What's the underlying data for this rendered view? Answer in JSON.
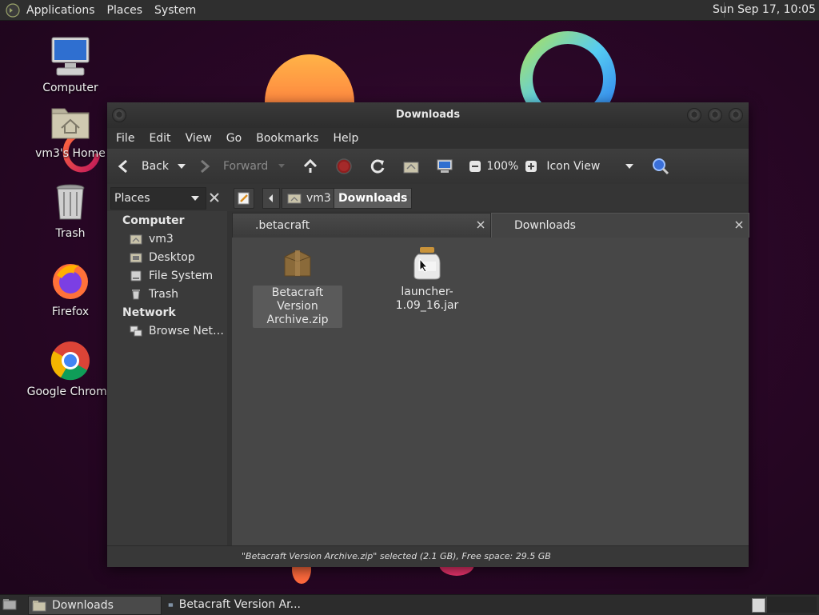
{
  "top_panel": {
    "menus": [
      "Applications",
      "Places",
      "System"
    ],
    "clock": "Sun Sep 17, 10:05"
  },
  "desktop_icons": [
    {
      "label": "Computer",
      "icon": "computer-icon"
    },
    {
      "label": "vm3's Home",
      "icon": "home-folder-icon"
    },
    {
      "label": "Trash",
      "icon": "trash-icon"
    },
    {
      "label": "Firefox",
      "icon": "firefox-icon"
    },
    {
      "label": "Google Chrome",
      "icon": "chrome-icon"
    }
  ],
  "window": {
    "title": "Downloads",
    "menus": [
      "File",
      "Edit",
      "View",
      "Go",
      "Bookmarks",
      "Help"
    ],
    "toolbar": {
      "back": "Back",
      "forward": "Forward",
      "zoom": "100%",
      "view_mode": "Icon View"
    },
    "places_label": "Places",
    "breadcrumbs": [
      "vm3",
      "Downloads"
    ],
    "sidebar": {
      "computer_heading": "Computer",
      "computer_items": [
        "vm3",
        "Desktop",
        "File System",
        "Trash"
      ],
      "network_heading": "Network",
      "network_items": [
        "Browse Net…"
      ]
    },
    "tabs": [
      ".betacraft",
      "Downloads"
    ],
    "files": [
      {
        "name": "Betacraft Version Archive.zip",
        "line1": "Betacraft Version",
        "line2": "Archive.zip",
        "icon": "zip-archive-icon",
        "selected": true
      },
      {
        "name": "launcher-1.09_16.jar",
        "icon": "jar-file-icon",
        "selected": false
      }
    ],
    "status": "\"Betacraft Version Archive.zip\" selected (2.1 GB), Free space: 29.5 GB"
  },
  "taskbar": {
    "tasks": [
      "Downloads",
      "Betacraft Version Ar..."
    ]
  },
  "colors": {
    "wallpaper": "#2a0727",
    "panel": "#2f2f2f",
    "window_bg": "#474747"
  }
}
